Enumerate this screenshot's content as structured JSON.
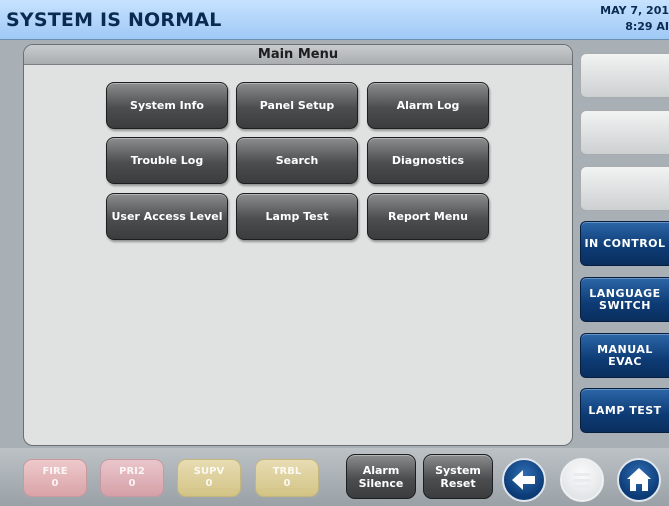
{
  "header": {
    "status": "SYSTEM IS NORMAL",
    "date": "MAY 7, 201",
    "time": "8:29 AI"
  },
  "main_menu": {
    "title": "Main Menu",
    "buttons": [
      "System Info",
      "Panel Setup",
      "Alarm Log",
      "Trouble Log",
      "Search",
      "Diagnostics",
      "User Access Level",
      "Lamp Test",
      "Report Menu"
    ]
  },
  "side_panel": {
    "in_control": "IN CONTROL",
    "language_switch_line1": "LANGUAGE",
    "language_switch_line2": "SWITCH",
    "manual_evac_line1": "MANUAL",
    "manual_evac_line2": "EVAC",
    "lamp_test": "LAMP TEST"
  },
  "bottom_bar": {
    "counters": [
      {
        "label": "FIRE",
        "count": "0"
      },
      {
        "label": "PRI2",
        "count": "0"
      },
      {
        "label": "SUPV",
        "count": "0"
      },
      {
        "label": "TRBL",
        "count": "0"
      }
    ],
    "alarm_silence": "Alarm\nSilence",
    "system_reset": "System\nReset",
    "icons": {
      "back": "arrow-left-icon",
      "menu": "menu-icon",
      "home": "home-icon"
    }
  },
  "colors": {
    "header_gradient_top": "#c7e2ff",
    "header_text": "#0b2a52",
    "side_blue": "#0d3b74",
    "menu_button_dark": "#4b4d4f"
  }
}
